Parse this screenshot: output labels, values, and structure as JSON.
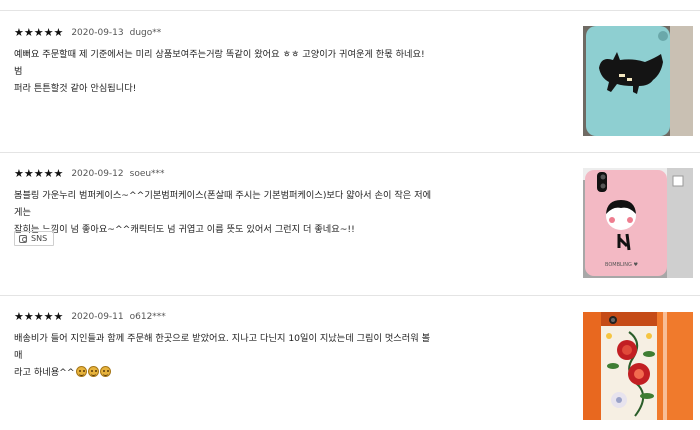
{
  "reviews": [
    {
      "stars": "★★★★★",
      "date": "2020-09-13",
      "user": "dugo**",
      "text_line1": "예뻐요 주문할때 제 기준에서는 미리 상품보여주는거랑 똑같이 왔어요 ㅎㅎ 고양이가 귀여운게 한몫 하네요! 범",
      "text_line2": "퍼라 튼튼할것 같아 안심됩니다!",
      "thumb": {
        "colors": [
          "#8ecfd1",
          "#1a1a1a",
          "#f4e7c0"
        ],
        "icon": "cat-phone-case-icon"
      }
    },
    {
      "stars": "★★★★★",
      "date": "2020-09-12",
      "user": "soeu***",
      "text_line1": "봄블링 가운누리 범퍼케이스~^^기본범퍼케이스(폰살때 주시는 기본범퍼케이스)보다 얇아서 손이 작은 저에게는",
      "text_line2": "잡히는 느낌이 넘 좋아요~^^캐릭터도 넘 귀엽고 이름 뜻도 있어서 그런지 더 좋네요~!!",
      "sns_label": "SNS",
      "thumb": {
        "colors": [
          "#f3b9c4",
          "#111111",
          "#e8e8e8"
        ],
        "caption": "BOMBLING ♥",
        "icon": "girl-phone-case-icon"
      }
    },
    {
      "stars": "★★★★★",
      "date": "2020-09-11",
      "user": "o612***",
      "text_line1": "배송비가 들어 지인들과 함께 주문해 한곳으로 받았어요. 지나고 다닌지 10일이 지났는데 그림이 멋스러워 볼매",
      "text_line2": "라고 하네용^^",
      "emojis": [
        "laughing-emoji-icon",
        "laughing-emoji-icon",
        "laughing-emoji-icon"
      ],
      "thumb": {
        "colors": [
          "#e8681f",
          "#c21f23",
          "#2a5d2a"
        ],
        "icon": "floral-phone-case-icon"
      }
    }
  ]
}
